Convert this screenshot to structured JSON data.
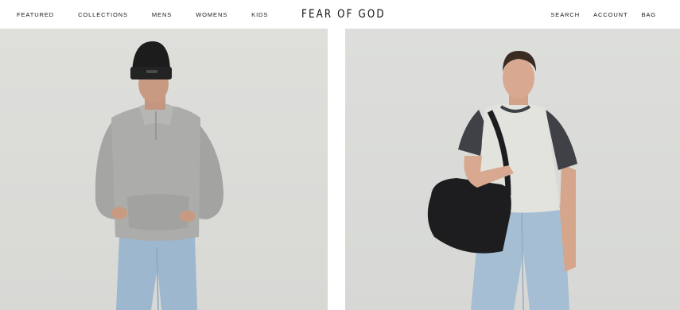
{
  "header": {
    "nav_left": [
      "FEATURED",
      "COLLECTIONS",
      "MENS",
      "WOMENS",
      "KIDS"
    ],
    "logo": "FEAR OF GOD",
    "nav_right": [
      "SEARCH",
      "ACCOUNT",
      "BAG"
    ]
  },
  "panels": [
    {
      "image": "model-in-grey-hoodie-and-black-beanie",
      "colors": {
        "hoodie": "#a9aaa7",
        "beanie": "#1c1c1c",
        "jeans": "#9db7cf",
        "skin": "#c99a82"
      }
    },
    {
      "image": "model-in-raglan-tee-with-black-bag",
      "colors": {
        "tee": "#e3e3de",
        "sleeves": "#3f4147",
        "bag": "#1d1d1f",
        "jeans": "#a6bed4",
        "skin": "#d8a990"
      }
    }
  ]
}
